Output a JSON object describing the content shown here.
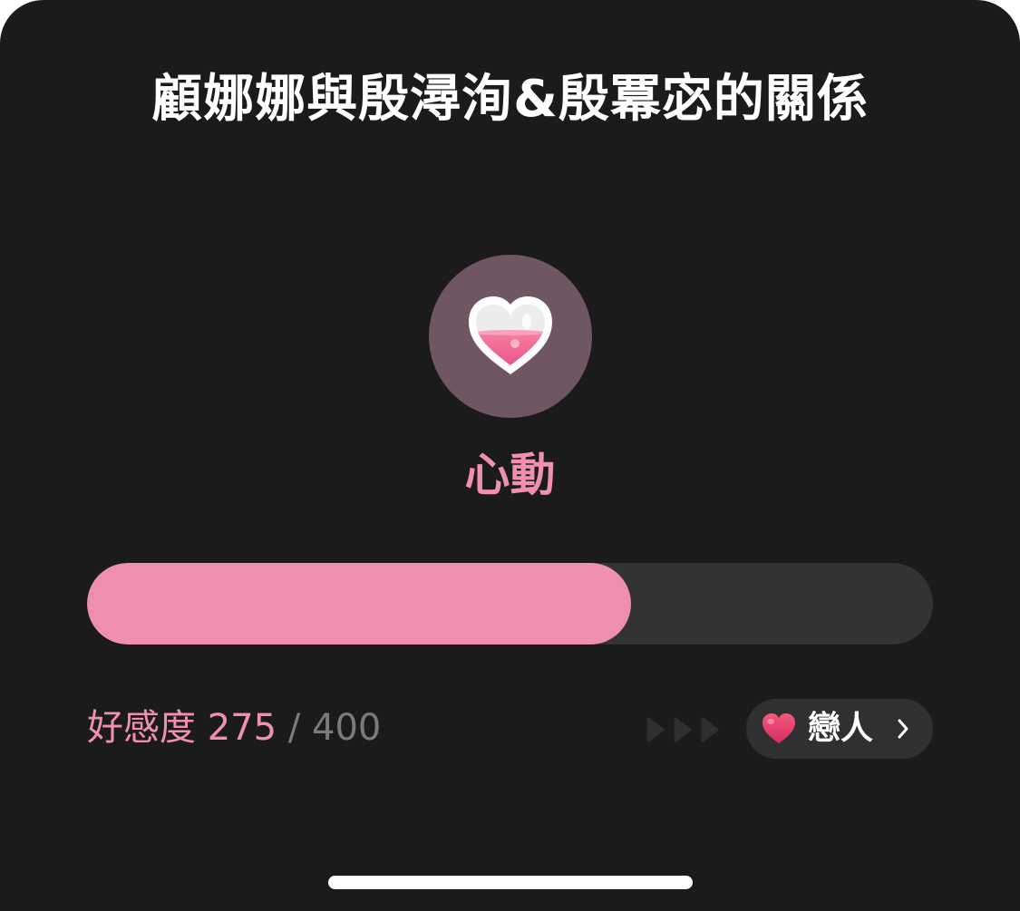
{
  "title": "顧娜娜與殷潯洵&殷冪宓的關係",
  "level": {
    "icon": "heart-potion-icon",
    "label": "心動",
    "accent_color": "#ef8fb1"
  },
  "progress": {
    "current": 275,
    "max": 400,
    "fraction": 0.6433,
    "fill_color": "#ee8fb0"
  },
  "score": {
    "label": "好感度",
    "current": "275",
    "separator": "/",
    "max": "400"
  },
  "next_level": {
    "icon": "heart-icon",
    "label": "戀人",
    "chevron": "chevron-right-icon"
  },
  "arrows_icon": "triple-play-arrows-icon",
  "colors": {
    "background": "#1b1b1b",
    "track": "#333333",
    "pill": "#303030",
    "circle": "#6e5663"
  }
}
